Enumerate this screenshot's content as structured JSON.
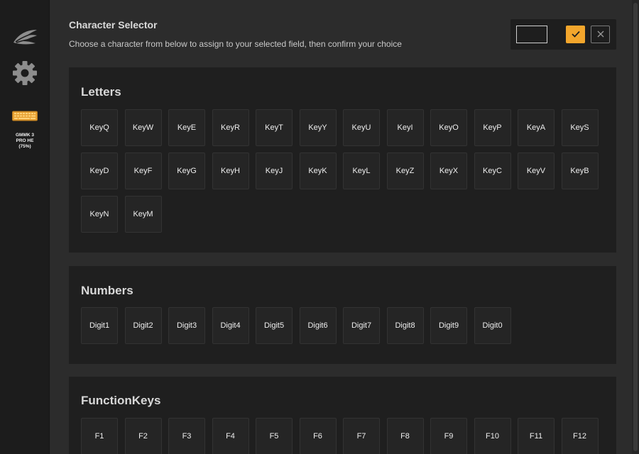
{
  "sidebar": {
    "logo_icon": "feather-wing-icon",
    "settings_icon": "gear-icon",
    "device": {
      "icon": "keyboard-icon",
      "label": "GMMK 3\nPRO HE\n(75%)"
    }
  },
  "header": {
    "title": "Character Selector",
    "subtitle": "Choose a character from below to assign to your selected field, then confirm your choice"
  },
  "confirm_bar": {
    "preview_value": "",
    "confirm_icon": "checkmark-icon",
    "cancel_icon": "close-icon"
  },
  "colors": {
    "accent": "#f3a62c"
  },
  "sections": {
    "letters": {
      "title": "Letters",
      "keys": [
        "KeyQ",
        "KeyW",
        "KeyE",
        "KeyR",
        "KeyT",
        "KeyY",
        "KeyU",
        "KeyI",
        "KeyO",
        "KeyP",
        "KeyA",
        "KeyS",
        "KeyD",
        "KeyF",
        "KeyG",
        "KeyH",
        "KeyJ",
        "KeyK",
        "KeyL",
        "KeyZ",
        "KeyX",
        "KeyC",
        "KeyV",
        "KeyB",
        "KeyN",
        "KeyM"
      ]
    },
    "numbers": {
      "title": "Numbers",
      "keys": [
        "Digit1",
        "Digit2",
        "Digit3",
        "Digit4",
        "Digit5",
        "Digit6",
        "Digit7",
        "Digit8",
        "Digit9",
        "Digit0"
      ]
    },
    "function_keys": {
      "title": "FunctionKeys",
      "keys": [
        "F1",
        "F2",
        "F3",
        "F4",
        "F5",
        "F6",
        "F7",
        "F8",
        "F9",
        "F10",
        "F11",
        "F12"
      ]
    }
  }
}
